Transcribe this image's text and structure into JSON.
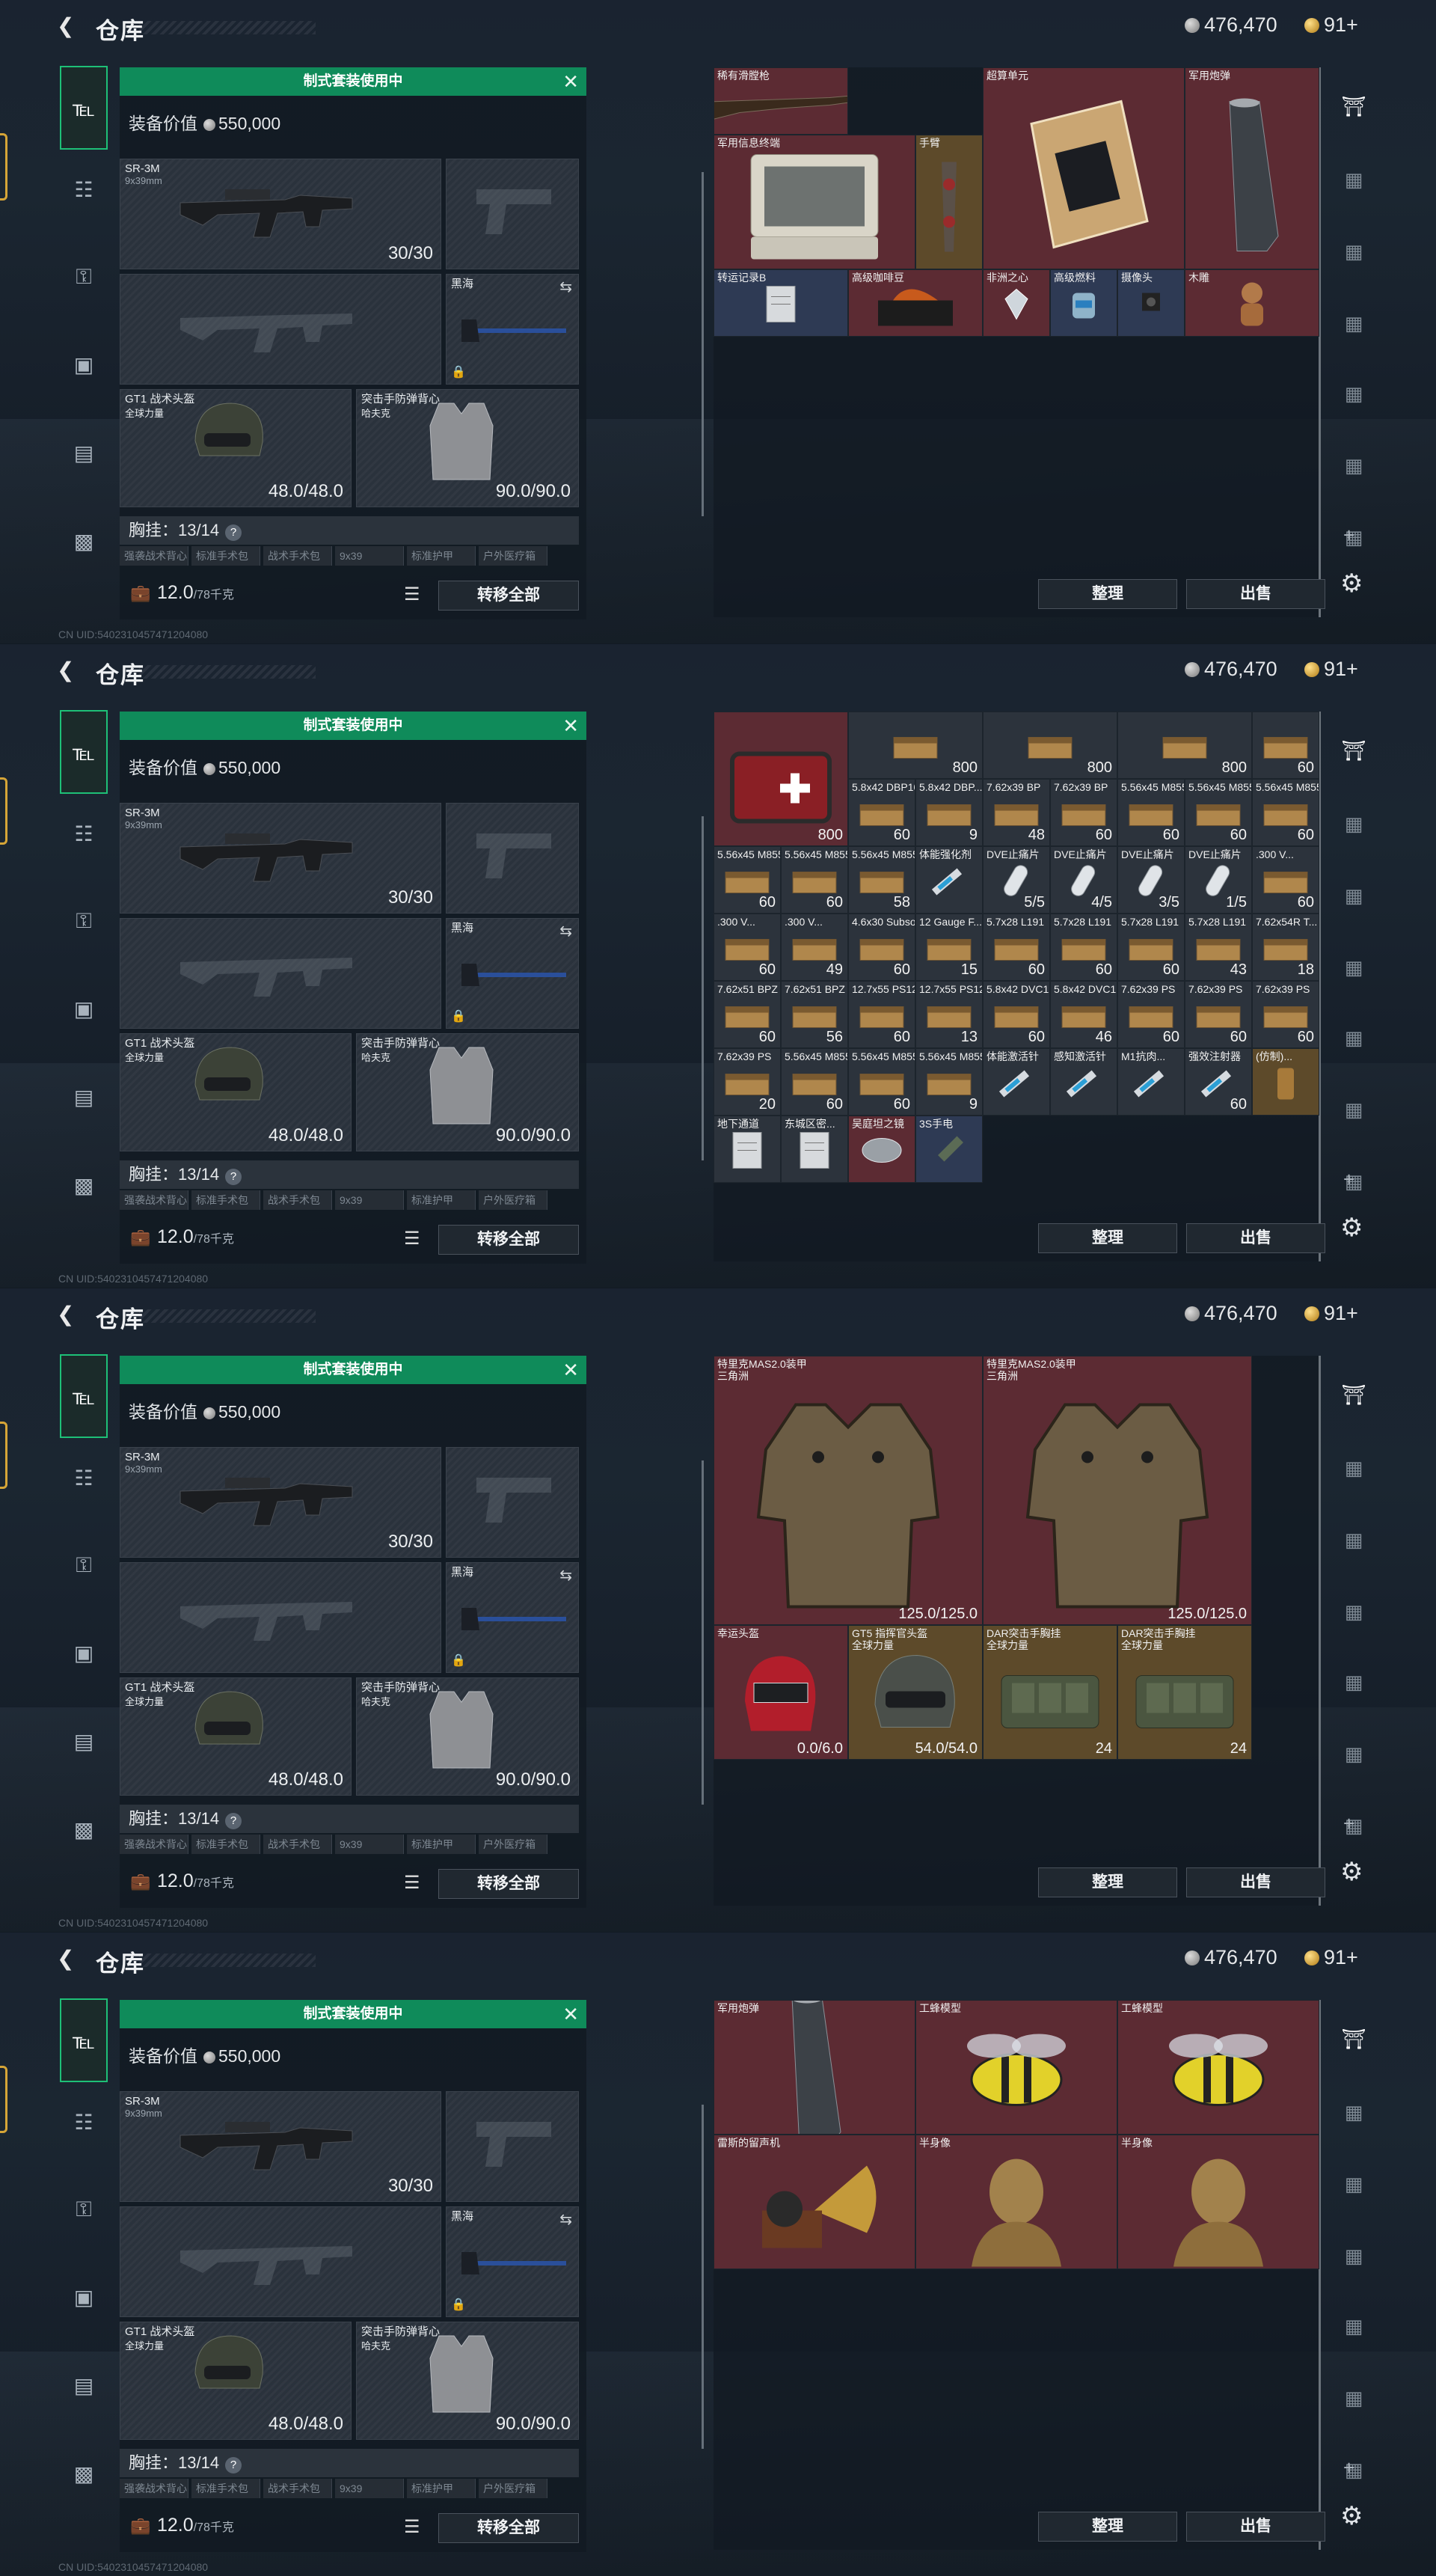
{
  "header": {
    "title": "仓库",
    "silver": "476,470",
    "gold": "91+"
  },
  "loadout": {
    "set_header": "制式套装使用中",
    "value_label": "装备价值",
    "value": "550,000",
    "primary_name": "SR-3M",
    "primary_ammo": "9x39mm",
    "primary_count": "30/30",
    "melee_name": "黑海",
    "helmet_name": "GT1 战术头盔",
    "helmet_sub": "全球力量",
    "helmet_dur": "48.0/48.0",
    "vest_name": "突击手防弹背心",
    "vest_sub": "哈夫克",
    "vest_dur": "90.0/90.0",
    "chest_label": "胸挂：13/14",
    "subslots": [
      "强袭战术背心",
      "标准手术包",
      "战术手术包",
      "9x39",
      "标准护甲",
      "户外医疗箱"
    ],
    "capacity": "12.0",
    "capacity_unit": "/78千克",
    "transfer_all": "转移全部"
  },
  "buttons": {
    "sort": "整理",
    "sell": "出售"
  },
  "frames": [
    {
      "cells": [
        {
          "name": "稀有滑膛枪",
          "col": 0,
          "row": 0,
          "w": 2,
          "h": 1,
          "bg": "red",
          "icon": "rifle"
        },
        {
          "name": "超算单元",
          "col": 4,
          "row": 0,
          "w": 3,
          "h": 3,
          "bg": "red",
          "icon": "gpu"
        },
        {
          "name": "军用炮弹",
          "col": 7,
          "row": 0,
          "w": 2,
          "h": 3,
          "bg": "red",
          "icon": "shell"
        },
        {
          "name": "军用信息终端",
          "col": 0,
          "row": 1,
          "w": 3,
          "h": 2,
          "bg": "red",
          "icon": "laptop"
        },
        {
          "name": "手臂",
          "col": 3,
          "row": 1,
          "w": 1,
          "h": 2,
          "bg": "gold",
          "icon": "arm"
        },
        {
          "name": "转运记录B",
          "col": 0,
          "row": 3,
          "w": 2,
          "h": 1,
          "bg": "blue",
          "icon": "paper"
        },
        {
          "name": "高级咖啡豆",
          "col": 2,
          "row": 3,
          "w": 2,
          "h": 1,
          "bg": "red",
          "icon": "coffee"
        },
        {
          "name": "非洲之心",
          "col": 4,
          "row": 3,
          "w": 1,
          "h": 1,
          "bg": "red",
          "icon": "diamond"
        },
        {
          "name": "高级燃料",
          "col": 5,
          "row": 3,
          "w": 1,
          "h": 1,
          "bg": "blue",
          "icon": "fuel"
        },
        {
          "name": "摄像头",
          "col": 6,
          "row": 3,
          "w": 1,
          "h": 1,
          "bg": "blue",
          "icon": "camera"
        },
        {
          "name": "木雕",
          "col": 7,
          "row": 3,
          "w": 2,
          "h": 1,
          "bg": "red",
          "icon": "statue"
        }
      ]
    },
    {
      "cells": [
        {
          "name": "",
          "col": 0,
          "row": 0,
          "w": 2,
          "h": 2,
          "bg": "red",
          "q": "800",
          "icon": "medkit"
        },
        {
          "name": "",
          "col": 2,
          "row": 0,
          "w": 2,
          "h": 1,
          "bg": "dark",
          "q": "800",
          "icon": "ammo"
        },
        {
          "name": "",
          "col": 4,
          "row": 0,
          "w": 2,
          "h": 1,
          "bg": "dark",
          "q": "800",
          "icon": "ammo"
        },
        {
          "name": "",
          "col": 6,
          "row": 0,
          "w": 2,
          "h": 1,
          "bg": "dark",
          "q": "800",
          "icon": "ammo"
        },
        {
          "name": "",
          "col": 8,
          "row": 0,
          "w": 1,
          "h": 1,
          "bg": "dark",
          "q": "60",
          "icon": "ammo"
        },
        {
          "name": "5.8x42 DBP10",
          "col": 2,
          "row": 1,
          "w": 1,
          "h": 1,
          "bg": "dark",
          "q": "60",
          "icon": "ammo"
        },
        {
          "name": "5.8x42 DBP...",
          "col": 3,
          "row": 1,
          "w": 1,
          "h": 1,
          "bg": "dark",
          "q": "9",
          "icon": "ammo"
        },
        {
          "name": "7.62x39 BP",
          "col": 4,
          "row": 1,
          "w": 1,
          "h": 1,
          "bg": "dark",
          "q": "48",
          "icon": "ammo"
        },
        {
          "name": "7.62x39 BP",
          "col": 5,
          "row": 1,
          "w": 1,
          "h": 1,
          "bg": "dark",
          "q": "60",
          "icon": "ammo"
        },
        {
          "name": "5.56x45 M855A1",
          "col": 6,
          "row": 1,
          "w": 1,
          "h": 1,
          "bg": "dark",
          "q": "60",
          "icon": "ammo"
        },
        {
          "name": "5.56x45 M855A1",
          "col": 7,
          "row": 1,
          "w": 1,
          "h": 1,
          "bg": "dark",
          "q": "60",
          "icon": "ammo"
        },
        {
          "name": "5.56x45 M855A1",
          "col": 8,
          "row": 1,
          "w": 1,
          "h": 1,
          "bg": "dark",
          "q": "60",
          "icon": "ammo"
        },
        {
          "name": "5.56x45 M855A1",
          "col": 0,
          "row": 2,
          "w": 1,
          "h": 1,
          "bg": "dark",
          "q": "60",
          "icon": "ammo"
        },
        {
          "name": "5.56x45 M855A1",
          "col": 1,
          "row": 2,
          "w": 1,
          "h": 1,
          "bg": "dark",
          "q": "60",
          "icon": "ammo"
        },
        {
          "name": "5.56x45 M855A1",
          "col": 2,
          "row": 2,
          "w": 1,
          "h": 1,
          "bg": "dark",
          "q": "58",
          "icon": "ammo"
        },
        {
          "name": "体能强化剂",
          "col": 3,
          "row": 2,
          "w": 1,
          "h": 1,
          "bg": "dark",
          "q": "",
          "icon": "syringe"
        },
        {
          "name": "DVE止痛片",
          "col": 4,
          "row": 2,
          "w": 1,
          "h": 1,
          "bg": "dark",
          "q": "5/5",
          "icon": "pill"
        },
        {
          "name": "DVE止痛片",
          "col": 5,
          "row": 2,
          "w": 1,
          "h": 1,
          "bg": "dark",
          "q": "4/5",
          "icon": "pill"
        },
        {
          "name": "DVE止痛片",
          "col": 6,
          "row": 2,
          "w": 1,
          "h": 1,
          "bg": "dark",
          "q": "3/5",
          "icon": "pill"
        },
        {
          "name": "DVE止痛片",
          "col": 7,
          "row": 2,
          "w": 1,
          "h": 1,
          "bg": "dark",
          "q": "1/5",
          "icon": "pill"
        },
        {
          "name": ".300 V...",
          "col": 8,
          "row": 2,
          "w": 1,
          "h": 1,
          "bg": "dark",
          "q": "60",
          "icon": "ammo"
        },
        {
          "name": ".300 V...",
          "col": 0,
          "row": 3,
          "w": 1,
          "h": 1,
          "bg": "dark",
          "q": "60",
          "icon": "ammo"
        },
        {
          "name": ".300 V...",
          "col": 1,
          "row": 3,
          "w": 1,
          "h": 1,
          "bg": "dark",
          "q": "49",
          "icon": "ammo"
        },
        {
          "name": "4.6x30 Subsonic",
          "col": 2,
          "row": 3,
          "w": 1,
          "h": 1,
          "bg": "dark",
          "q": "60",
          "icon": "ammo"
        },
        {
          "name": "12 Gauge F...",
          "col": 3,
          "row": 3,
          "w": 1,
          "h": 1,
          "bg": "dark",
          "q": "15",
          "icon": "ammo"
        },
        {
          "name": "5.7x28 L191",
          "col": 4,
          "row": 3,
          "w": 1,
          "h": 1,
          "bg": "dark",
          "q": "60",
          "icon": "ammo"
        },
        {
          "name": "5.7x28 L191",
          "col": 5,
          "row": 3,
          "w": 1,
          "h": 1,
          "bg": "dark",
          "q": "60",
          "icon": "ammo"
        },
        {
          "name": "5.7x28 L191",
          "col": 6,
          "row": 3,
          "w": 1,
          "h": 1,
          "bg": "dark",
          "q": "60",
          "icon": "ammo"
        },
        {
          "name": "5.7x28 L191",
          "col": 7,
          "row": 3,
          "w": 1,
          "h": 1,
          "bg": "dark",
          "q": "43",
          "icon": "ammo"
        },
        {
          "name": "7.62x54R T...",
          "col": 8,
          "row": 3,
          "w": 1,
          "h": 1,
          "bg": "dark",
          "q": "18",
          "icon": "ammo"
        },
        {
          "name": "7.62x51 BPZ",
          "col": 0,
          "row": 4,
          "w": 1,
          "h": 1,
          "bg": "dark",
          "q": "60",
          "icon": "ammo"
        },
        {
          "name": "7.62x51 BPZ",
          "col": 1,
          "row": 4,
          "w": 1,
          "h": 1,
          "bg": "dark",
          "q": "56",
          "icon": "ammo"
        },
        {
          "name": "12.7x55 PS12A",
          "col": 2,
          "row": 4,
          "w": 1,
          "h": 1,
          "bg": "dark",
          "q": "60",
          "icon": "ammo"
        },
        {
          "name": "12.7x55 PS12A",
          "col": 3,
          "row": 4,
          "w": 1,
          "h": 1,
          "bg": "dark",
          "q": "13",
          "icon": "ammo"
        },
        {
          "name": "5.8x42 DVC12",
          "col": 4,
          "row": 4,
          "w": 1,
          "h": 1,
          "bg": "dark",
          "q": "60",
          "icon": "ammo"
        },
        {
          "name": "5.8x42 DVC12",
          "col": 5,
          "row": 4,
          "w": 1,
          "h": 1,
          "bg": "dark",
          "q": "46",
          "icon": "ammo"
        },
        {
          "name": "7.62x39 PS",
          "col": 6,
          "row": 4,
          "w": 1,
          "h": 1,
          "bg": "dark",
          "q": "60",
          "icon": "ammo"
        },
        {
          "name": "7.62x39 PS",
          "col": 7,
          "row": 4,
          "w": 1,
          "h": 1,
          "bg": "dark",
          "q": "60",
          "icon": "ammo"
        },
        {
          "name": "7.62x39 PS",
          "col": 8,
          "row": 4,
          "w": 1,
          "h": 1,
          "bg": "dark",
          "q": "60",
          "icon": "ammo"
        },
        {
          "name": "7.62x39 PS",
          "col": 0,
          "row": 5,
          "w": 1,
          "h": 1,
          "bg": "dark",
          "q": "20",
          "icon": "ammo"
        },
        {
          "name": "5.56x45 M855",
          "col": 1,
          "row": 5,
          "w": 1,
          "h": 1,
          "bg": "dark",
          "q": "60",
          "icon": "ammo"
        },
        {
          "name": "5.56x45 M855",
          "col": 2,
          "row": 5,
          "w": 1,
          "h": 1,
          "bg": "dark",
          "q": "60",
          "icon": "ammo"
        },
        {
          "name": "5.56x45 M855",
          "col": 3,
          "row": 5,
          "w": 1,
          "h": 1,
          "bg": "dark",
          "q": "9",
          "icon": "ammo"
        },
        {
          "name": "体能激活针",
          "col": 4,
          "row": 5,
          "w": 1,
          "h": 1,
          "bg": "dark",
          "q": "",
          "icon": "syringe"
        },
        {
          "name": "感知激活针",
          "col": 5,
          "row": 5,
          "w": 1,
          "h": 1,
          "bg": "dark",
          "q": "",
          "icon": "syringe"
        },
        {
          "name": "M1抗肉...",
          "col": 6,
          "row": 5,
          "w": 1,
          "h": 1,
          "bg": "dark",
          "q": "",
          "icon": "syringe"
        },
        {
          "name": "强效注射器",
          "col": 7,
          "row": 5,
          "w": 1,
          "h": 1,
          "bg": "dark",
          "q": "60",
          "icon": "syringe"
        },
        {
          "name": "(仿制)...",
          "col": 8,
          "row": 5,
          "w": 1,
          "h": 1,
          "bg": "gold",
          "q": "",
          "icon": "bottle"
        },
        {
          "name": "地下通道",
          "col": 0,
          "row": 6,
          "w": 1,
          "h": 1,
          "bg": "dark",
          "q": "",
          "icon": "paper"
        },
        {
          "name": "东城区密...",
          "col": 1,
          "row": 6,
          "w": 1,
          "h": 1,
          "bg": "dark",
          "q": "",
          "icon": "paper"
        },
        {
          "name": "吴庭坦之镜",
          "col": 2,
          "row": 6,
          "w": 1,
          "h": 1,
          "bg": "red",
          "q": "",
          "icon": "mirror"
        },
        {
          "name": "3S手电",
          "col": 3,
          "row": 6,
          "w": 1,
          "h": 1,
          "bg": "blue",
          "q": "",
          "icon": "torch"
        }
      ]
    },
    {
      "cells": [
        {
          "name": "特里克MAS2.0装甲",
          "sub": "三角洲",
          "col": 0,
          "row": 0,
          "w": 4,
          "h": 4,
          "bg": "red",
          "q": "125.0/125.0",
          "icon": "armor"
        },
        {
          "name": "特里克MAS2.0装甲",
          "sub": "三角洲",
          "col": 4,
          "row": 0,
          "w": 4,
          "h": 4,
          "bg": "red",
          "q": "125.0/125.0",
          "icon": "armor"
        },
        {
          "name": "幸运头盔",
          "col": 0,
          "row": 4,
          "w": 2,
          "h": 2,
          "bg": "red",
          "q": "0.0/6.0",
          "icon": "redhelm"
        },
        {
          "name": "GT5 指挥官头盔",
          "sub": "全球力量",
          "col": 2,
          "row": 4,
          "w": 2,
          "h": 2,
          "bg": "gold",
          "q": "54.0/54.0",
          "icon": "helm"
        },
        {
          "name": "DAR突击手胸挂",
          "sub": "全球力量",
          "col": 4,
          "row": 4,
          "w": 2,
          "h": 2,
          "bg": "gold",
          "q": "24",
          "icon": "rig"
        },
        {
          "name": "DAR突击手胸挂",
          "sub": "全球力量",
          "col": 6,
          "row": 4,
          "w": 2,
          "h": 2,
          "bg": "gold",
          "q": "24",
          "icon": "rig"
        }
      ]
    },
    {
      "cells": [
        {
          "name": "军用炮弹",
          "col": 0,
          "row": 0,
          "w": 3,
          "h": 2,
          "bg": "red",
          "icon": "shell"
        },
        {
          "name": "工蜂模型",
          "col": 3,
          "row": 0,
          "w": 3,
          "h": 2,
          "bg": "red",
          "icon": "bee"
        },
        {
          "name": "工蜂模型",
          "col": 6,
          "row": 0,
          "w": 3,
          "h": 2,
          "bg": "red",
          "icon": "bee"
        },
        {
          "name": "雷斯的留声机",
          "col": 0,
          "row": 2,
          "w": 3,
          "h": 2,
          "bg": "red",
          "icon": "gramophone"
        },
        {
          "name": "半身像",
          "col": 3,
          "row": 2,
          "w": 3,
          "h": 2,
          "bg": "red",
          "icon": "bust"
        },
        {
          "name": "半身像",
          "col": 6,
          "row": 2,
          "w": 3,
          "h": 2,
          "bg": "red",
          "icon": "bust"
        }
      ]
    }
  ],
  "footer": "CN UID:5402310457471204080",
  "colors": {
    "accent": "#0f8b5a",
    "rare_red": "#5c2b33",
    "epic_gold": "#5d4a2a",
    "blue": "#2e3a54"
  }
}
